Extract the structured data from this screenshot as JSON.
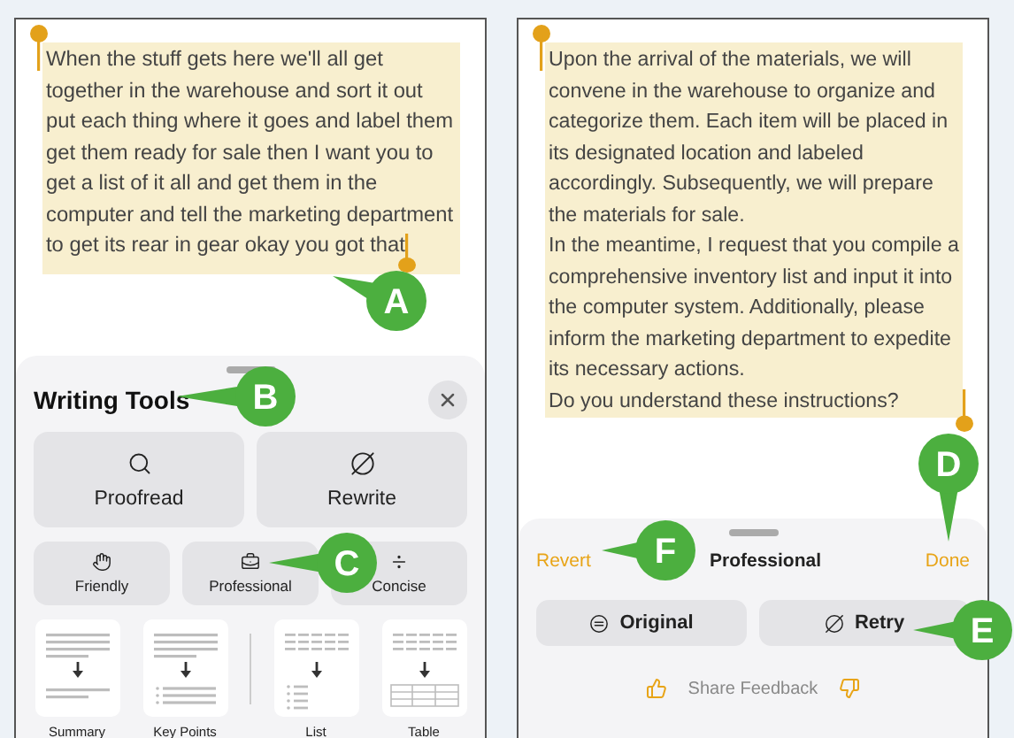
{
  "left_screen": {
    "text": "When the stuff gets here we'll all get together in the warehouse and sort it out put each thing where it goes and label them get them ready for sale then I want you to get a list of it all and get them in the computer and tell the marketing department to get its rear in gear okay you got that",
    "writing_tools": {
      "title": "Writing Tools",
      "main_actions": [
        "Proofread",
        "Rewrite"
      ],
      "tones": [
        "Friendly",
        "Professional",
        "Concise"
      ],
      "formats": [
        {
          "kind": "summary",
          "label": "Summary"
        },
        {
          "kind": "key_points",
          "label": "Key Points"
        },
        {
          "kind": "list",
          "label": "List"
        },
        {
          "kind": "table",
          "label": "Table"
        }
      ]
    }
  },
  "right_screen": {
    "paragraphs": [
      "Upon the arrival of the materials, we will convene in the warehouse to organize and categorize them. Each item will be placed in its designated location and labeled accordingly. Subsequently, we will prepare the materials for sale.",
      "In the meantime, I request that you compile a comprehensive inventory list and input it into the computer system. Additionally, please inform the marketing department to expedite its necessary actions.",
      "Do you understand these instructions?"
    ],
    "sheet": {
      "revert": "Revert",
      "title": "Professional",
      "done": "Done",
      "buttons": [
        "Original",
        "Retry"
      ],
      "feedback": "Share Feedback"
    }
  },
  "callouts": [
    {
      "label": "A"
    },
    {
      "label": "B"
    },
    {
      "label": "C"
    },
    {
      "label": "D"
    },
    {
      "label": "E"
    },
    {
      "label": "F"
    }
  ]
}
